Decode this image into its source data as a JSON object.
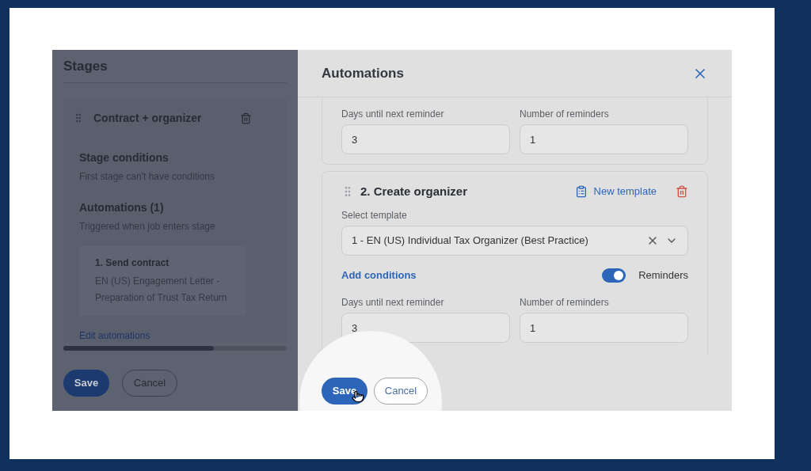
{
  "stages_panel": {
    "title": "Stages",
    "stage": {
      "name": "Contract + organizer",
      "conditions_title": "Stage conditions",
      "conditions_note": "First stage can't have conditions",
      "automations_title": "Automations (1)",
      "automations_note": "Triggered when job enters stage",
      "automation": {
        "title": "1. Send contract",
        "description": "EN (US) Engagement Letter - Preparation of Trust Tax Return"
      },
      "edit_link": "Edit automations"
    },
    "buttons": [
      "Save",
      "Cancel"
    ]
  },
  "drawer": {
    "title": "Automations",
    "automations": [
      {
        "kind": "partial",
        "days_label": "Days until next reminder",
        "days_value": "3",
        "count_label": "Number of reminders",
        "count_value": "1"
      },
      {
        "kind": "full",
        "title": "2. Create organizer",
        "new_template": "New template",
        "template_label": "Select template",
        "template_value": "1 - EN (US) Individual Tax Organizer (Best Practice)",
        "add_conditions": "Add conditions",
        "reminders_label": "Reminders",
        "reminders_on": true,
        "days_label": "Days until next reminder",
        "days_value": "3",
        "count_label": "Number of reminders",
        "count_value": "1"
      }
    ],
    "buttons": [
      "Save",
      "Cancel"
    ]
  }
}
